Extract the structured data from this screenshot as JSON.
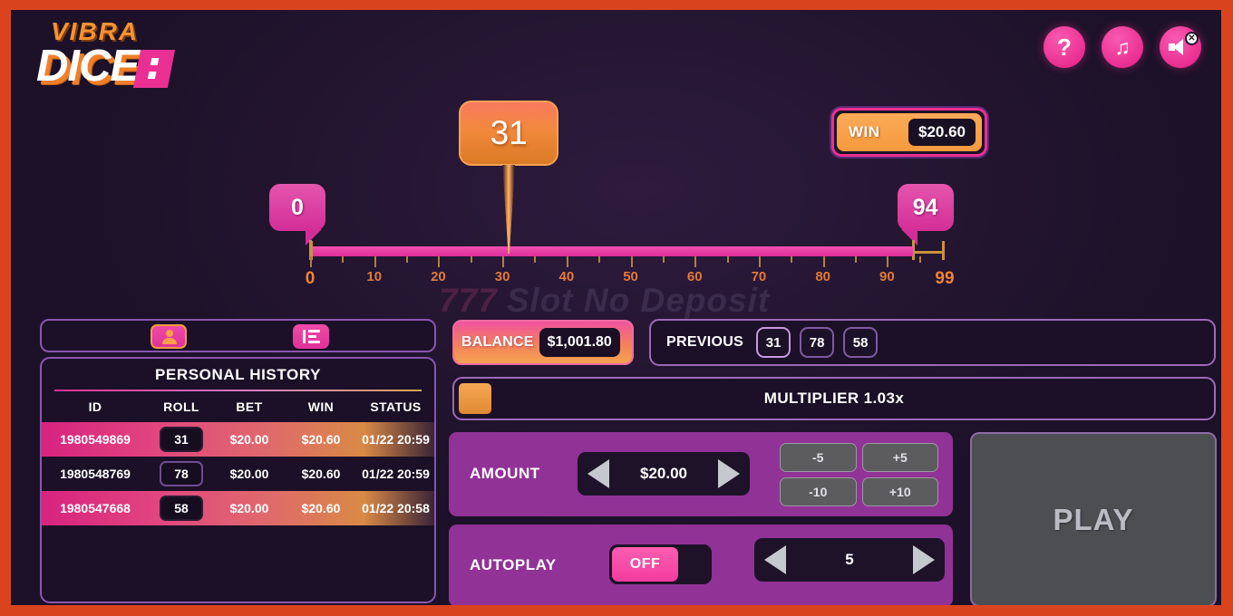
{
  "brand": {
    "top": "VIBRA",
    "bottom": "DICE",
    "chip_icon": "dice-chip-icon"
  },
  "topbar": {
    "help_label": "?",
    "music_icon": "music-note-icon",
    "sound_icon": "speaker-muted-icon",
    "sound_badge": "✕"
  },
  "win_badge": {
    "label": "WIN",
    "amount": "$20.60"
  },
  "slider": {
    "min_handle": "0",
    "max_handle": "94",
    "roll_value": "31",
    "range_start": 0,
    "range_end": 99,
    "fill_to": 94,
    "tick_labels": [
      "0",
      "10",
      "20",
      "30",
      "40",
      "50",
      "60",
      "70",
      "80",
      "90",
      "99"
    ]
  },
  "tabs": [
    {
      "name": "personal-history-tab",
      "icon": "person-icon",
      "active": true
    },
    {
      "name": "all-history-tab",
      "icon": "list-icon",
      "active": false
    }
  ],
  "history": {
    "title": "PERSONAL HISTORY",
    "columns": [
      "ID",
      "ROLL",
      "BET",
      "WIN",
      "STATUS"
    ],
    "rows": [
      {
        "id": "1980549869",
        "roll": "31",
        "bet": "$20.00",
        "win": "$20.60",
        "status": "01/22 20:59",
        "highlight": true
      },
      {
        "id": "1980548769",
        "roll": "78",
        "bet": "$20.00",
        "win": "$20.60",
        "status": "01/22 20:59",
        "highlight": false
      },
      {
        "id": "1980547668",
        "roll": "58",
        "bet": "$20.00",
        "win": "$20.60",
        "status": "01/22 20:58",
        "highlight": true
      }
    ]
  },
  "balance": {
    "label": "BALANCE",
    "value": "$1,001.80"
  },
  "previous": {
    "label": "PREVIOUS",
    "rolls": [
      "31",
      "78",
      "58"
    ]
  },
  "multiplier": {
    "text": "MULTIPLIER 1.03x"
  },
  "amount": {
    "label": "AMOUNT",
    "value": "$20.00",
    "quick_buttons": [
      "-5",
      "+5",
      "-10",
      "+10"
    ]
  },
  "autoplay": {
    "label": "AUTOPLAY",
    "toggle_state": "OFF",
    "count": "5"
  },
  "play": {
    "label": "PLAY",
    "enabled": false
  },
  "watermark": {
    "seven": "777",
    "text": "Slot No Deposit"
  },
  "colors": {
    "frame": "#d9441f",
    "stage": "#241531",
    "pink": "#ea2f92",
    "orange": "#f2893c",
    "purple_panel": "#913296",
    "border_purple": "#8a55b0"
  }
}
